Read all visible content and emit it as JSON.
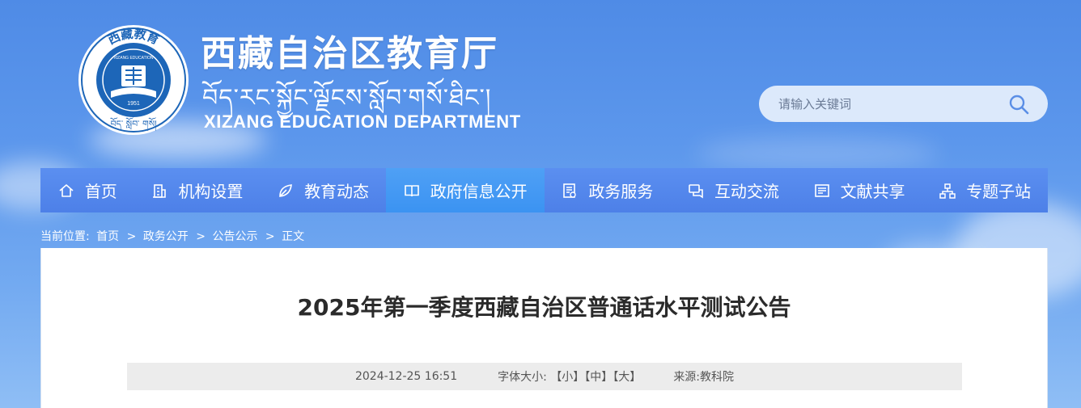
{
  "header": {
    "title_cn": "西藏自治区教育厅",
    "title_tibetan": "བོད་རང་སྐྱོང་ལྗོངས་སློབ་གསོ་ཐིང་།",
    "title_en": "XIZANG EDUCATION DEPARTMENT",
    "emblem": {
      "top_text": "西藏教育",
      "inner_text": "XIZANG EDUCATION",
      "year": "1951",
      "bottom_text": "བོད་ སློབ་ གསོ།",
      "color": "#1d66b8"
    }
  },
  "search": {
    "placeholder": "请输入关键词",
    "icon": "search-icon"
  },
  "nav": {
    "items": [
      {
        "label": "首页",
        "icon": "home-icon"
      },
      {
        "label": "机构设置",
        "icon": "building-icon"
      },
      {
        "label": "教育动态",
        "icon": "leaf-icon"
      },
      {
        "label": "政府信息公开",
        "icon": "book-icon",
        "active": true
      },
      {
        "label": "政务服务",
        "icon": "document-icon"
      },
      {
        "label": "互动交流",
        "icon": "chat-icon"
      },
      {
        "label": "文献共享",
        "icon": "folder-icon"
      },
      {
        "label": "专题子站",
        "icon": "network-icon"
      }
    ],
    "active_color": "#3b93f2"
  },
  "breadcrumb": {
    "prefix": "当前位置:",
    "items": [
      "首页",
      "政务公开",
      "公告公示",
      "正文"
    ],
    "separator": ">"
  },
  "article": {
    "title": "2025年第一季度西藏自治区普通话水平测试公告",
    "date": "2024-12-25 16:51",
    "font_size_label": "字体大小:",
    "font_sizes": [
      "【小】",
      "【中】",
      "【大】"
    ],
    "source": "来源:教科院"
  }
}
